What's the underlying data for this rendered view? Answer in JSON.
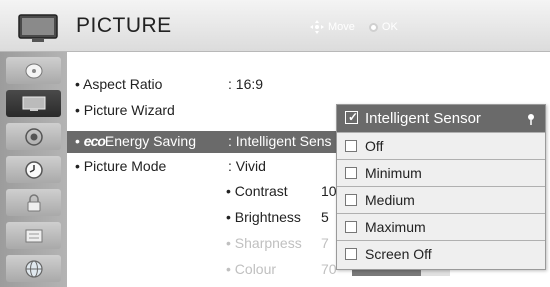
{
  "header": {
    "title": "PICTURE",
    "hint_move": "Move",
    "hint_ok": "OK",
    "icon": "tv-icon"
  },
  "sidebar": {
    "items": [
      {
        "icon": "satellite-dish-icon"
      },
      {
        "icon": "tv-picture-icon",
        "active": true
      },
      {
        "icon": "speaker-icon"
      },
      {
        "icon": "clock-icon"
      },
      {
        "icon": "lock-icon"
      },
      {
        "icon": "option-icon"
      },
      {
        "icon": "globe-icon"
      }
    ]
  },
  "menu": {
    "rows": [
      {
        "label": "Aspect Ratio",
        "value": ": 16:9"
      },
      {
        "label": "Picture Wizard",
        "value": ""
      },
      {
        "label_prefix": "eco",
        "label": "Energy Saving",
        "value": ": Intelligent Sens"
      },
      {
        "label": "Picture Mode",
        "value": ": Vivid"
      }
    ],
    "sub_settings": [
      {
        "label": "• Contrast",
        "value": "10",
        "level": 1.0,
        "dim": false
      },
      {
        "label": "• Brightness",
        "value": "5",
        "level": 0.5,
        "dim": false
      },
      {
        "label": "• Sharpness",
        "value": "7",
        "level": 0.7,
        "dim": true
      },
      {
        "label": "• Colour",
        "value": "70",
        "level": 0.7,
        "dim": true
      }
    ]
  },
  "dropdown": {
    "selected": "Intelligent Sensor",
    "options": [
      "Off",
      "Minimum",
      "Medium",
      "Maximum",
      "Screen Off"
    ]
  }
}
